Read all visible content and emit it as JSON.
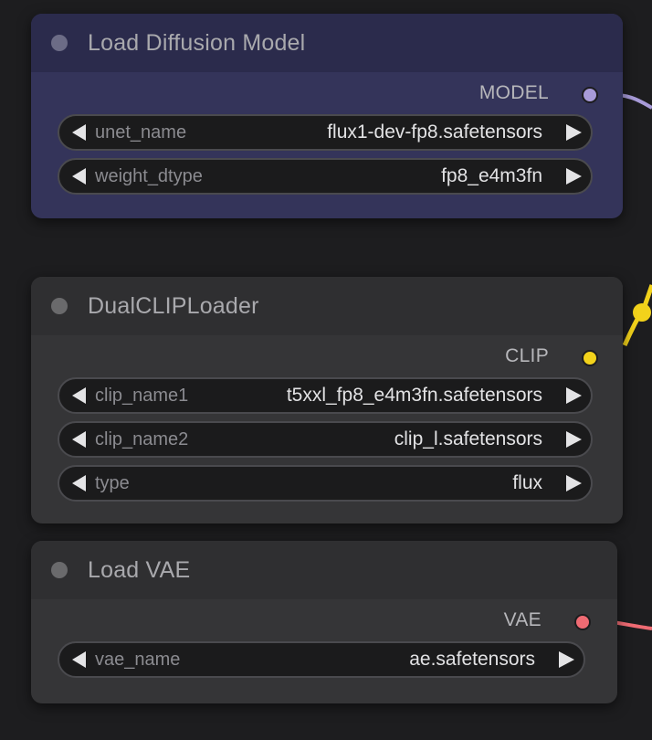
{
  "nodes": {
    "diffusion": {
      "title": "Load Diffusion Model",
      "output": "MODEL",
      "widgets": [
        {
          "label": "unet_name",
          "value": "flux1-dev-fp8.safetensors"
        },
        {
          "label": "weight_dtype",
          "value": "fp8_e4m3fn"
        }
      ]
    },
    "clip": {
      "title": "DualCLIPLoader",
      "output": "CLIP",
      "widgets": [
        {
          "label": "clip_name1",
          "value": "t5xxl_fp8_e4m3fn.safetensors"
        },
        {
          "label": "clip_name2",
          "value": "clip_l.safetensors"
        },
        {
          "label": "type",
          "value": "flux"
        }
      ]
    },
    "vae": {
      "title": "Load VAE",
      "output": "VAE",
      "widgets": [
        {
          "label": "vae_name",
          "value": "ae.safetensors"
        }
      ]
    }
  },
  "colors": {
    "model_link": "#a89bd9",
    "clip_link": "#f2d21b",
    "vae_link": "#ef6b73",
    "model_node_bg": "#34345a",
    "model_node_title_bg": "#2b2b4c",
    "default_node_bg": "#353537",
    "default_node_title_bg": "#2f2f31"
  }
}
